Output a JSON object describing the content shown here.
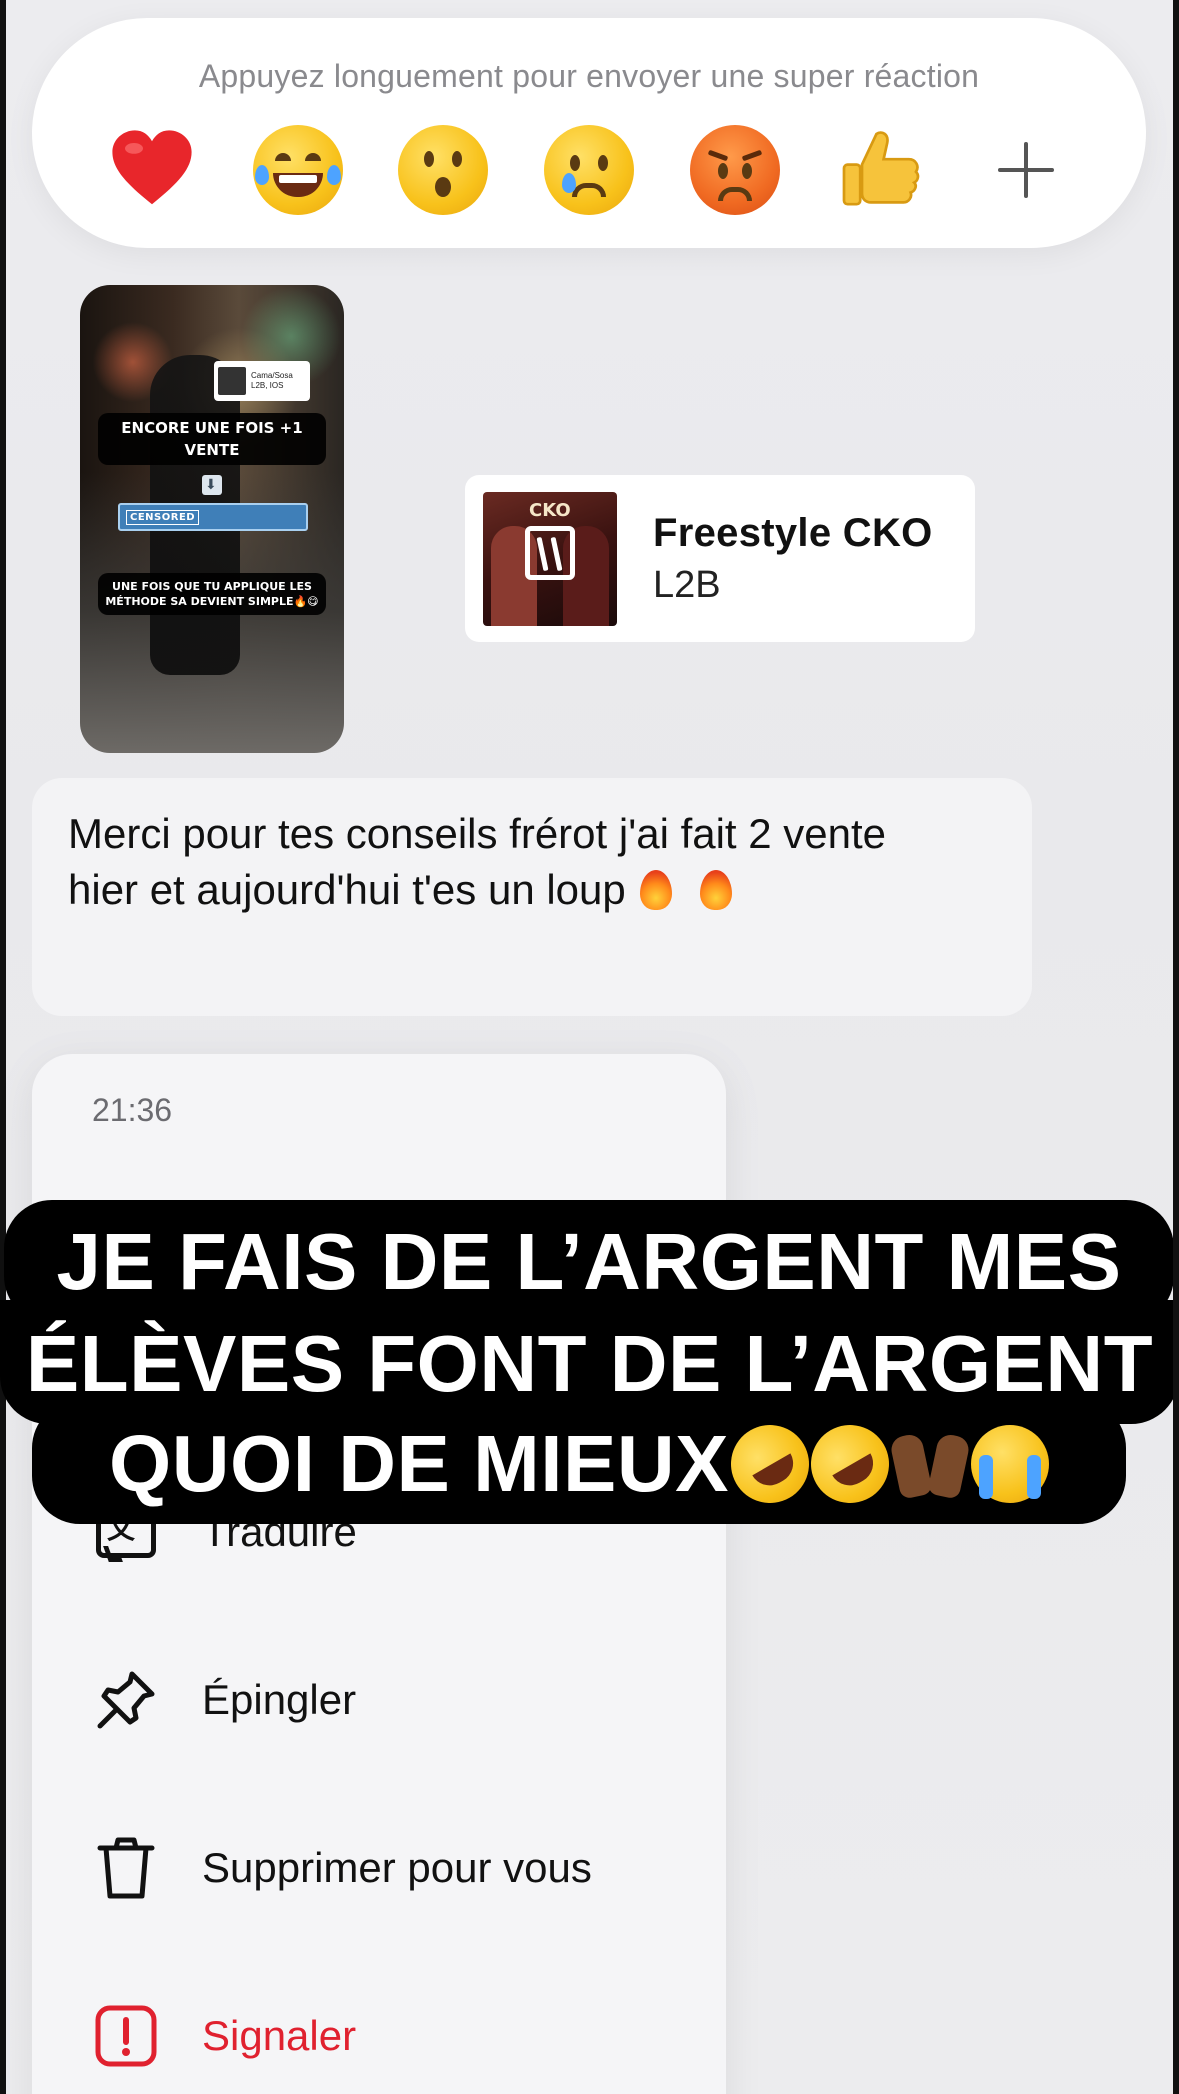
{
  "reaction_bar": {
    "hint": "Appuyez longuement pour envoyer une super réaction",
    "reactions": [
      {
        "name": "heart",
        "icon": "red-heart-icon"
      },
      {
        "name": "laughing",
        "icon": "face-with-tears-of-joy-icon"
      },
      {
        "name": "surprised",
        "icon": "astonished-face-icon"
      },
      {
        "name": "sad",
        "icon": "crying-face-icon"
      },
      {
        "name": "angry",
        "icon": "angry-face-icon"
      },
      {
        "name": "thumbs-up",
        "icon": "thumbs-up-icon"
      },
      {
        "name": "more",
        "icon": "plus-icon"
      }
    ]
  },
  "story_thumbnail": {
    "mini_card": {
      "line1": "Cama/Sosa",
      "line2": "L2B, IOS"
    },
    "caption_top": "ENCORE UNE FOIS +1 VENTE",
    "censored_tag": "CENSORED",
    "caption_bottom": "UNE FOIS QUE TU APPLIQUE LES MÉTHODE SA DEVIENT SIMPLE🔥😋"
  },
  "music_card": {
    "cover_label": "CKO",
    "title": "Freestyle CKO",
    "artist": "L2B"
  },
  "message": {
    "text": "Merci pour tes conseils frérot j'ai fait 2 vente hier et aujourd'hui t'es un loup",
    "emoji_count": 2
  },
  "context_menu": {
    "timestamp": "21:36",
    "items": [
      {
        "label": "Traduire",
        "icon": "translate-icon"
      },
      {
        "label": "Épingler",
        "icon": "pin-icon"
      },
      {
        "label": "Supprimer pour vous",
        "icon": "trash-icon"
      },
      {
        "label": "Signaler",
        "icon": "report-icon"
      }
    ]
  },
  "overlay_caption": {
    "line1": "JE FAIS DE L’ARGENT MES",
    "line2": "ÉLÈVES FONT DE L’ARGENT",
    "line3": "QUOI DE MIEUX"
  },
  "colors": {
    "danger": "#e0212f",
    "hint_gray": "#8a8a8e",
    "overlay_bg": "#000000"
  }
}
